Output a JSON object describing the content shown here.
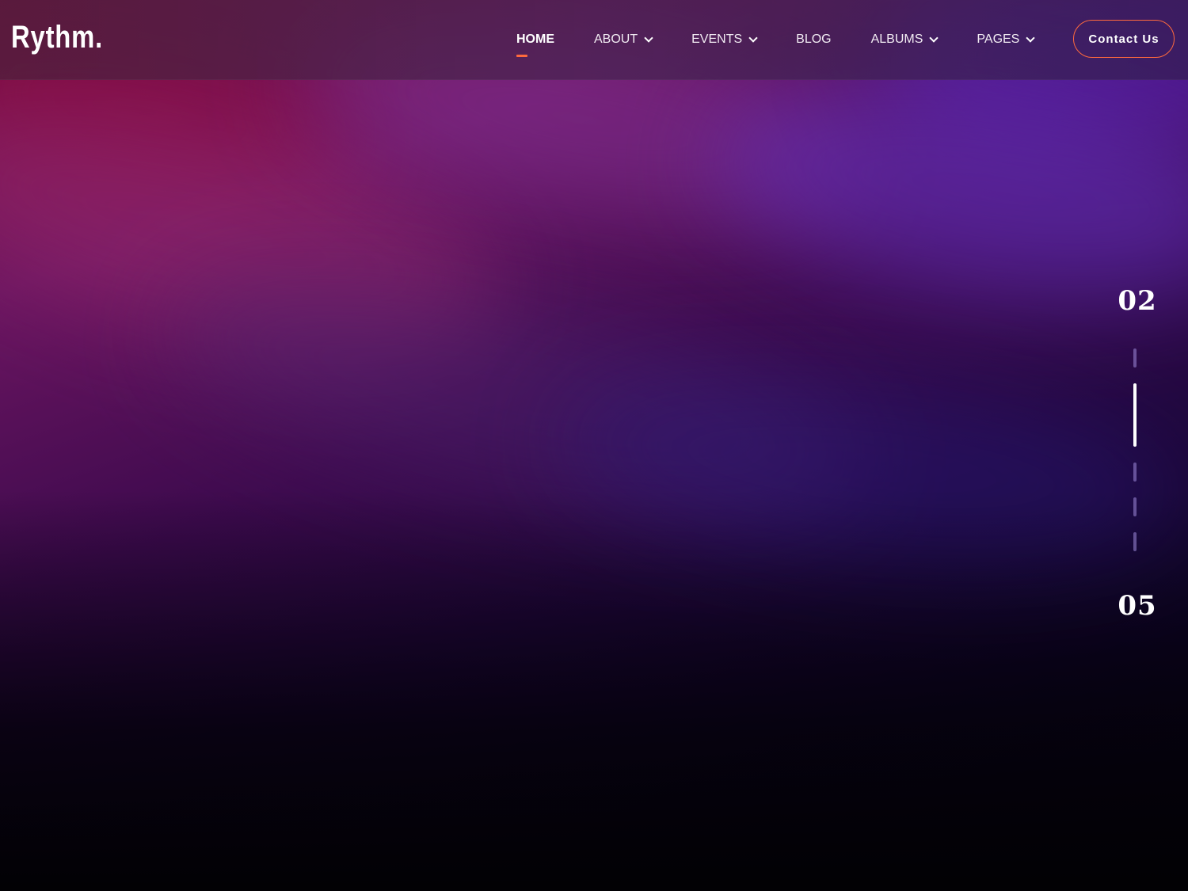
{
  "brand": {
    "logo_text": "Rythm.",
    "accent_color": "#ff6a3d"
  },
  "nav": {
    "items": [
      {
        "label": "HOME",
        "active": true,
        "has_dropdown": false
      },
      {
        "label": "ABOUT",
        "active": false,
        "has_dropdown": true
      },
      {
        "label": "EVENTS",
        "active": false,
        "has_dropdown": true
      },
      {
        "label": "BLOG",
        "active": false,
        "has_dropdown": false
      },
      {
        "label": "ALBUMS",
        "active": false,
        "has_dropdown": true
      },
      {
        "label": "PAGES",
        "active": false,
        "has_dropdown": true
      }
    ],
    "contact_label": "Contact Us"
  },
  "slider": {
    "current": "02",
    "total": "05",
    "active_index": 1,
    "count": 5
  }
}
